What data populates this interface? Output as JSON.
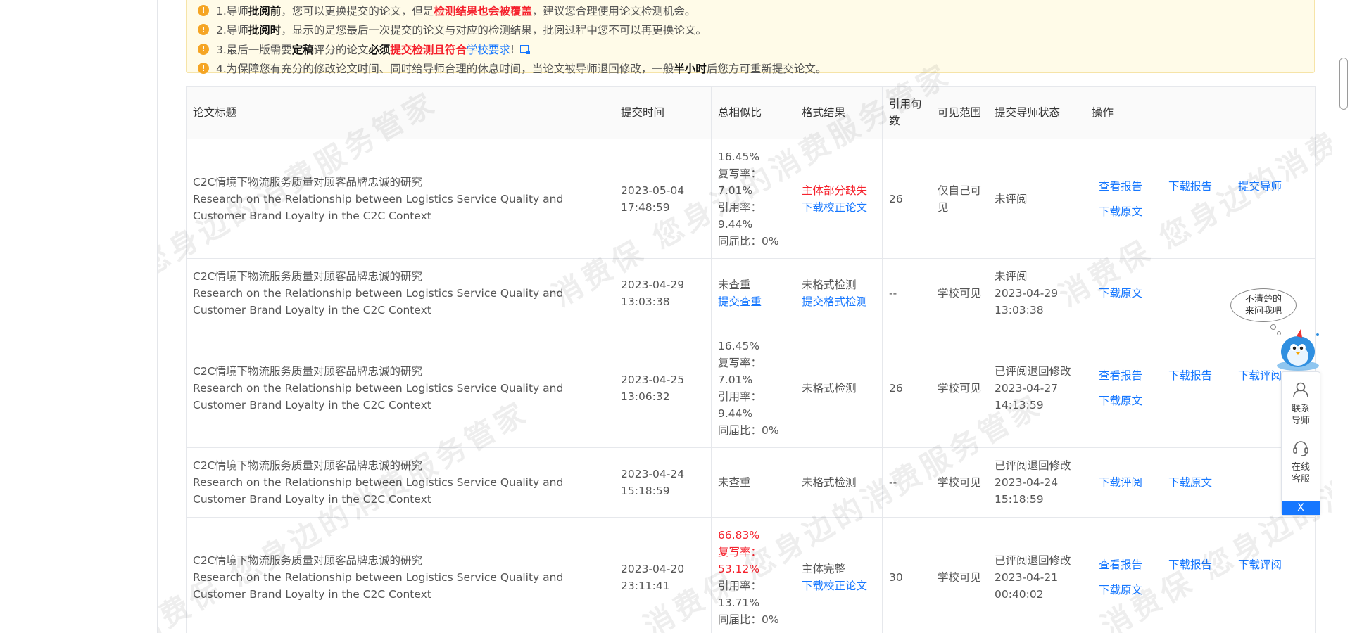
{
  "notice": {
    "line1_prefix": "1.导师",
    "line1_bold": "批阅前",
    "line1_mid": "，您可以更换提交的论文，但是",
    "line1_red": "检测结果也会被覆盖",
    "line1_suffix": "，建议您合理使用论文检测机会。",
    "line2_prefix": "2.导师",
    "line2_bold": "批阅时",
    "line2_suffix": "，显示的是您最后一次提交的论文与对应的检测结果，批阅过程中您不可以再更换论文。",
    "line3_prefix": "3.最后一版需要",
    "line3_bold1": "定稿",
    "line3_mid": "评分的论文",
    "line3_bold2": "必须",
    "line3_red": "提交检测且符合",
    "line3_link": "学校要求",
    "line3_suffix": "!",
    "line4_prefix": "4.为保障您有充分的修改论文时间、同时给导师合理的休息时间，当论文被导师退回修改，一般",
    "line4_bold": "半小时",
    "line4_suffix": "后您方可重新提交论文。"
  },
  "table": {
    "headers": [
      "论文标题",
      "提交时间",
      "总相似比",
      "格式结果",
      "引用句数",
      "可见范围",
      "提交导师状态",
      "操作"
    ],
    "rows": [
      {
        "title_cn": "C2C情境下物流服务质量对顾客品牌忠诚的研究",
        "title_en": "Research on the Relationship between Logistics Service Quality and Customer Brand Loyalty in the C2C Context",
        "time": "2023-05-04 17:48:59",
        "sim_total": "16.45%",
        "sim_copy": "复写率：7.01%",
        "sim_cite": "引用率：9.44%",
        "sim_peer": "同届比：0%",
        "format_text": "主体部分缺失",
        "format_link": "下载校正论文",
        "cite_count": "26",
        "scope": "仅自己可见",
        "status": "未评阅",
        "status_date": "",
        "ops": [
          "查看报告",
          "下载报告",
          "提交导师",
          "下载原文"
        ]
      },
      {
        "title_cn": "C2C情境下物流服务质量对顾客品牌忠诚的研究",
        "title_en": "Research on the Relationship between Logistics Service Quality and Customer Brand Loyalty in the C2C Context",
        "time": "2023-04-29 13:03:38",
        "sim_total": "未查重",
        "sim_link": "提交查重",
        "format_text": "未格式检测",
        "format_link": "提交格式检测",
        "cite_count": "--",
        "scope": "学校可见",
        "status": "未评阅",
        "status_date": "2023-04-29 13:03:38",
        "ops": [
          "下载原文"
        ]
      },
      {
        "title_cn": "C2C情境下物流服务质量对顾客品牌忠诚的研究",
        "title_en": "Research on the Relationship between Logistics Service Quality and Customer Brand Loyalty in the C2C Context",
        "time": "2023-04-25 13:06:32",
        "sim_total": "16.45%",
        "sim_copy": "复写率：7.01%",
        "sim_cite": "引用率：9.44%",
        "sim_peer": "同届比：0%",
        "format_text": "未格式检测",
        "cite_count": "26",
        "scope": "学校可见",
        "status": "已评阅退回修改",
        "status_date": "2023-04-27 14:13:59",
        "ops": [
          "查看报告",
          "下载报告",
          "下载评阅",
          "下载原文"
        ]
      },
      {
        "title_cn": "C2C情境下物流服务质量对顾客品牌忠诚的研究",
        "title_en": "Research on the Relationship between Logistics Service Quality and Customer Brand Loyalty in the C2C Context",
        "time": "2023-04-24 15:18:59",
        "sim_total": "未查重",
        "format_text": "未格式检测",
        "cite_count": "--",
        "scope": "学校可见",
        "status": "已评阅退回修改",
        "status_date": "2023-04-24 15:18:59",
        "ops": [
          "下载评阅",
          "下载原文"
        ]
      },
      {
        "title_cn": "C2C情境下物流服务质量对顾客品牌忠诚的研究",
        "title_en": "Research on the Relationship between Logistics Service Quality and Customer Brand Loyalty in the C2C Context",
        "time": "2023-04-20 23:11:41",
        "sim_total": "66.83%",
        "sim_copy": "复写率：53.12%",
        "sim_cite": "引用率：13.71%",
        "sim_peer": "同届比：0%",
        "format_text": "主体完整",
        "format_link": "下载校正论文",
        "cite_count": "30",
        "scope": "学校可见",
        "status": "已评阅退回修改",
        "status_date": "2023-04-21 00:40:02",
        "ops": [
          "查看报告",
          "下载报告",
          "下载评阅",
          "下载原文"
        ]
      }
    ]
  },
  "watermark_text": "消费保 您身边的消费服务管家",
  "assistant": {
    "bubble_line1": "不清楚的",
    "bubble_line2": "来问我吧",
    "contact_label1": "联系",
    "contact_label2": "导师",
    "service_label1": "在线",
    "service_label2": "客服",
    "close_label": "X"
  },
  "colors": {
    "link": "#1677ff",
    "warning": "#f5222d",
    "notice_bg": "#fffbe8",
    "notice_icon": "#f5a524"
  }
}
